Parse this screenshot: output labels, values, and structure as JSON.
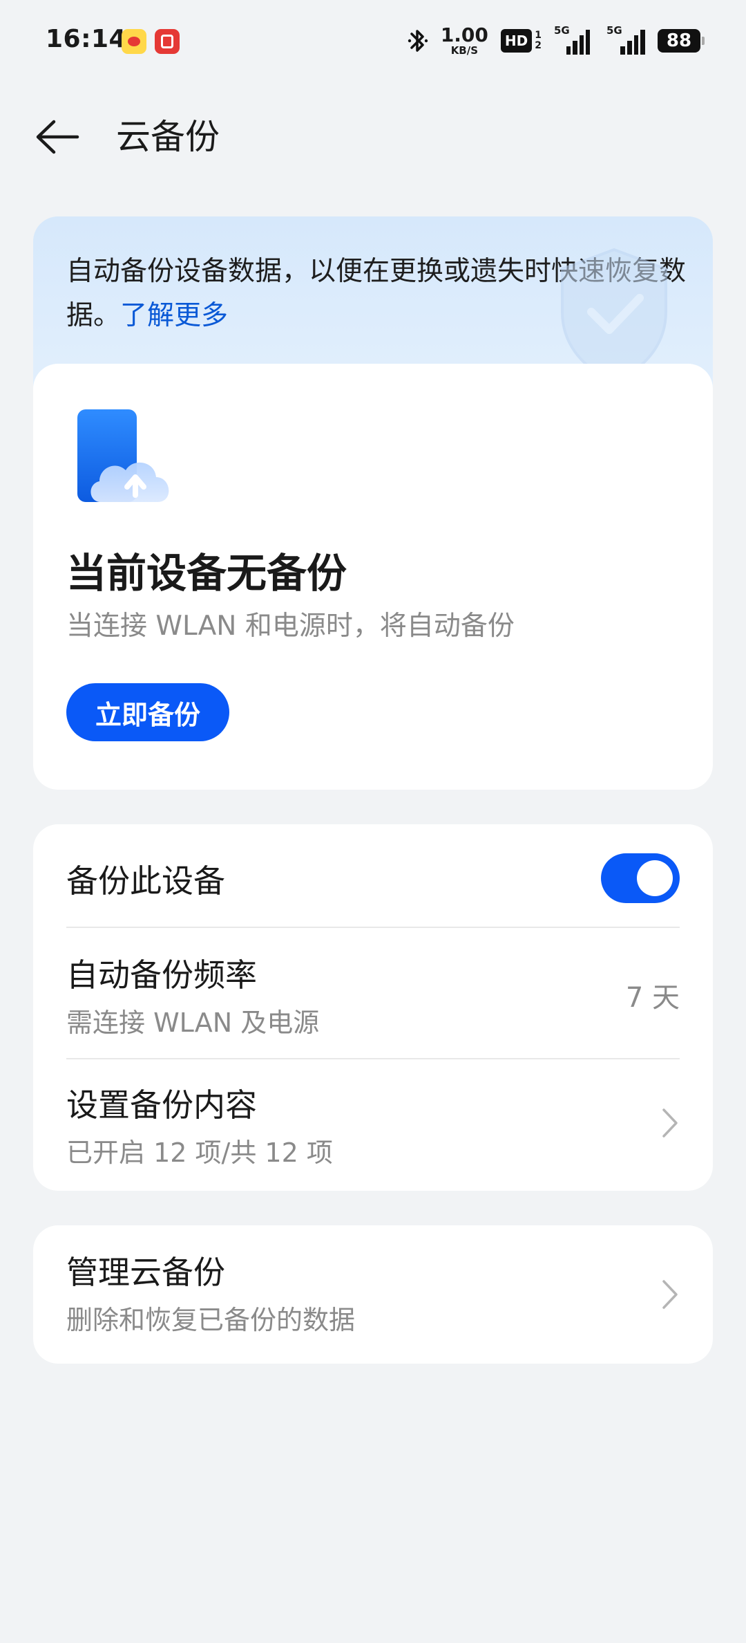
{
  "status_bar": {
    "time": "16:14",
    "net_speed_value": "1.00",
    "net_speed_unit": "KB/S",
    "hd_label": "HD",
    "hd_sim1": "1",
    "hd_sim2": "2",
    "signal1_label": "5G",
    "signal2_label": "5G",
    "battery": "88"
  },
  "header": {
    "title": "云备份"
  },
  "banner": {
    "text": "自动备份设备数据，以便在更换或遗失时快速恢复数据。",
    "link": "了解更多"
  },
  "backup_status": {
    "title": "当前设备无备份",
    "subtitle": "当连接 WLAN 和电源时，将自动备份",
    "button_label": "立即备份"
  },
  "settings": {
    "backup_device": {
      "label": "备份此设备",
      "enabled": true
    },
    "frequency": {
      "label": "自动备份频率",
      "sub": "需连接 WLAN 及电源",
      "value": "7 天"
    },
    "content": {
      "label": "设置备份内容",
      "sub": "已开启 12 项/共 12 项"
    }
  },
  "manage": {
    "label": "管理云备份",
    "sub": "删除和恢复已备份的数据"
  },
  "colors": {
    "accent": "#0a59f7",
    "link": "#0a59d6",
    "background": "#f1f3f5",
    "banner": "#d6e8fb"
  }
}
